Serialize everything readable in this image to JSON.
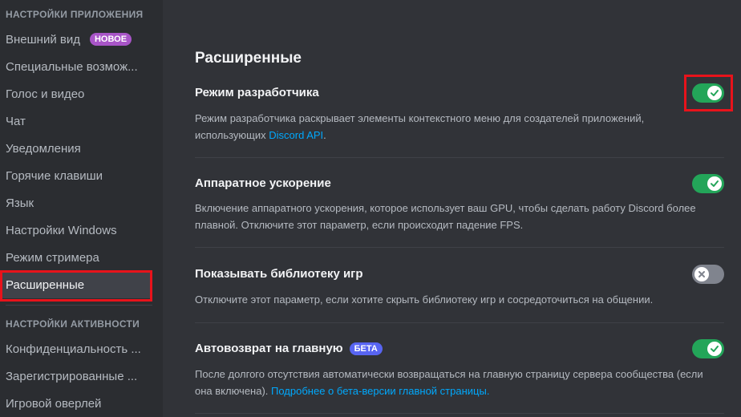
{
  "sidebar": {
    "section_app": "НАСТРОЙКИ ПРИЛОЖЕНИЯ",
    "section_activity": "НАСТРОЙКИ АКТИВНОСТИ",
    "items": [
      {
        "label": "Внешний вид",
        "badge": "НОВОЕ"
      },
      {
        "label": "Специальные возмож..."
      },
      {
        "label": "Голос и видео"
      },
      {
        "label": "Чат"
      },
      {
        "label": "Уведомления"
      },
      {
        "label": "Горячие клавиши"
      },
      {
        "label": "Язык"
      },
      {
        "label": "Настройки Windows"
      },
      {
        "label": "Режим стримера"
      },
      {
        "label": "Расширенные"
      }
    ],
    "activity_items": [
      {
        "label": "Конфиденциальность ..."
      },
      {
        "label": "Зарегистрированные ..."
      },
      {
        "label": "Игровой оверлей"
      }
    ]
  },
  "main": {
    "title": "Расширенные",
    "settings": [
      {
        "title": "Режим разработчика",
        "desc_text": "Режим разработчика раскрывает элементы контекстного меню для создателей приложений, использующих ",
        "desc_link": "Discord API",
        "desc_after": ".",
        "enabled": true
      },
      {
        "title": "Аппаратное ускорение",
        "desc_text": "Включение аппаратного ускорения, которое использует ваш GPU, чтобы сделать работу Discord более плавной. Отключите этот параметр, если происходит падение FPS.",
        "enabled": true
      },
      {
        "title": "Показывать библиотеку игр",
        "desc_text": "Отключите этот параметр, если хотите скрыть библиотеку игр и сосредоточиться на общении.",
        "enabled": false
      },
      {
        "title": "Автовозврат на главную",
        "badge": "БЕТА",
        "desc_text": "После долгого отсутствия автоматически возвращаться на главную страницу сервера сообщества (если она включена). ",
        "desc_link": "Подробнее о бета-версии главной страницы.",
        "enabled": true
      }
    ]
  },
  "colors": {
    "toggle_on": "#23a559",
    "toggle_off": "#80848e",
    "link": "#00a8fc",
    "highlight": "#e8131b"
  },
  "icons": {
    "toggle_on": "check-icon",
    "toggle_off": "x-icon"
  }
}
